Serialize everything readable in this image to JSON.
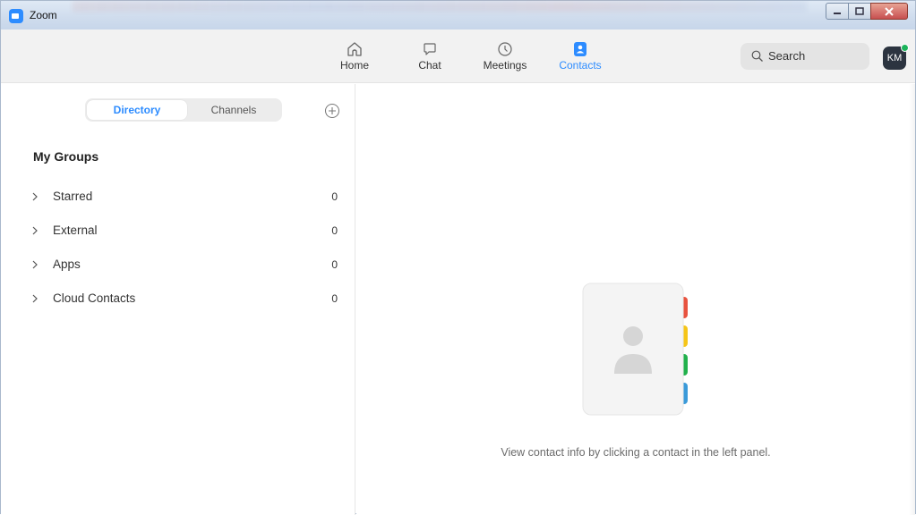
{
  "window": {
    "title": "Zoom"
  },
  "nav": {
    "items": [
      {
        "label": "Home",
        "icon": "home-icon"
      },
      {
        "label": "Chat",
        "icon": "chat-icon"
      },
      {
        "label": "Meetings",
        "icon": "clock-icon"
      },
      {
        "label": "Contacts",
        "icon": "contacts-icon",
        "active": true
      }
    ],
    "search_label": "Search",
    "avatar_initials": "KM",
    "accent_color": "#2d8cff"
  },
  "sidebar": {
    "tabs": [
      "Directory",
      "Channels"
    ],
    "active_tab": "Directory",
    "groups_title": "My Groups",
    "groups": [
      {
        "label": "Starred",
        "count": "0"
      },
      {
        "label": "External",
        "count": "0"
      },
      {
        "label": "Apps",
        "count": "0"
      },
      {
        "label": "Cloud Contacts",
        "count": "0"
      }
    ]
  },
  "main": {
    "empty_message": "View contact info by clicking a contact in the left panel."
  }
}
